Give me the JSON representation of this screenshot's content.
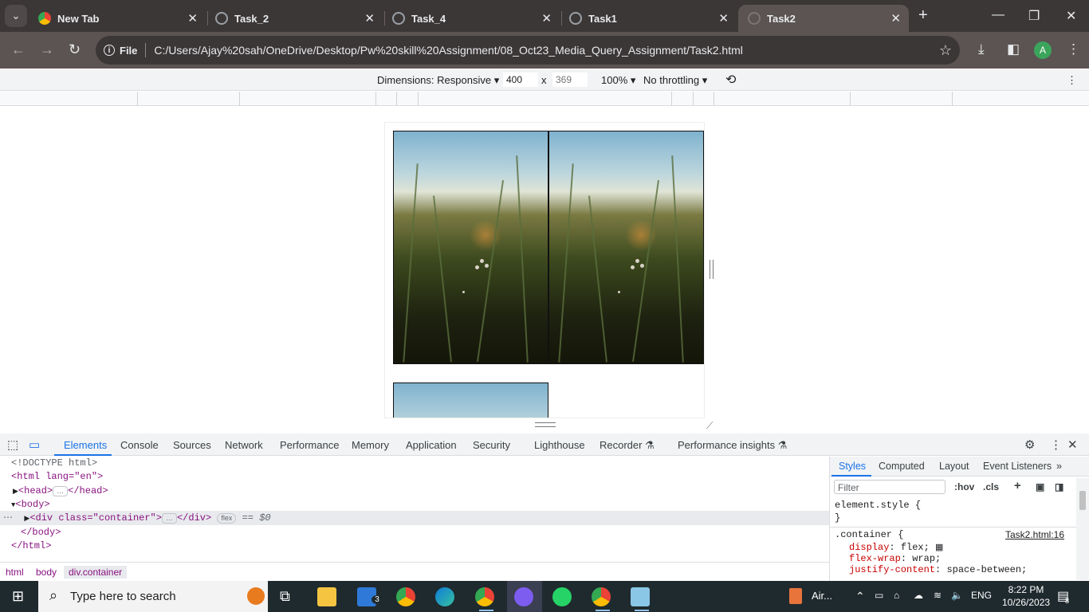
{
  "browser": {
    "tabs": [
      {
        "label": "New Tab",
        "icon": "chrome-icon",
        "active": false
      },
      {
        "label": "Task_2",
        "icon": "globe-icon",
        "active": false
      },
      {
        "label": "Task_4",
        "icon": "globe-icon",
        "active": false
      },
      {
        "label": "Task1",
        "icon": "globe-icon",
        "active": false
      },
      {
        "label": "Task2",
        "icon": "globe-icon",
        "active": true
      }
    ],
    "close_glyph": "✕",
    "new_tab_glyph": "+",
    "address": {
      "scheme_label": "File",
      "url": "C:/Users/Ajay%20sah/OneDrive/Desktop/Pw%20skill%20Assignment/08_Oct23_Media_Query_Assignment/Task2.html"
    },
    "profile_initial": "A"
  },
  "device_toolbar": {
    "dimensions_label": "Dimensions: Responsive",
    "width_value": "400",
    "times_glyph": "x",
    "height_placeholder": "369",
    "zoom_label": "100%",
    "throttling_label": "No throttling"
  },
  "devtools": {
    "tabs": [
      "Elements",
      "Console",
      "Sources",
      "Network",
      "Performance",
      "Memory",
      "Application",
      "Security",
      "Lighthouse",
      "Recorder",
      "Performance insights"
    ],
    "active_tab": "Elements",
    "dom": {
      "doctype": "<!DOCTYPE html>",
      "html_open": "<html lang=\"en\">",
      "head": "<head>",
      "head_close": "</head>",
      "body_open": "<body>",
      "div_open": "<div class=\"container\">",
      "div_close": "</div>",
      "flex_badge": "flex",
      "dollar_zero": "== $0",
      "body_close": "</body>",
      "html_close": "</html>"
    },
    "breadcrumbs": [
      "html",
      "body",
      "div.container"
    ],
    "styles_panel": {
      "tabs": [
        "Styles",
        "Computed",
        "Layout",
        "Event Listeners"
      ],
      "filter_placeholder": "Filter",
      "hov": ":hov",
      "cls": ".cls",
      "element_style": "element.style {",
      "close_brace": "}",
      "selector": ".container {",
      "source_link": "Task2.html:16",
      "declarations": [
        {
          "prop": "display",
          "value": "flex;"
        },
        {
          "prop": "flex-wrap",
          "value": "wrap;"
        },
        {
          "prop": "justify-content",
          "value": "space-between;"
        }
      ]
    }
  },
  "taskbar": {
    "search_placeholder": "Type here to search",
    "mail_badge": "3",
    "air_label": "Air...",
    "lang": "ENG",
    "time": "8:22 PM",
    "date": "10/26/2023",
    "notif_count": "8"
  },
  "colors": {
    "chrome_dark": "#3c3737",
    "toolbar": "#5c5452",
    "devtools_accent": "#1a73e8"
  }
}
